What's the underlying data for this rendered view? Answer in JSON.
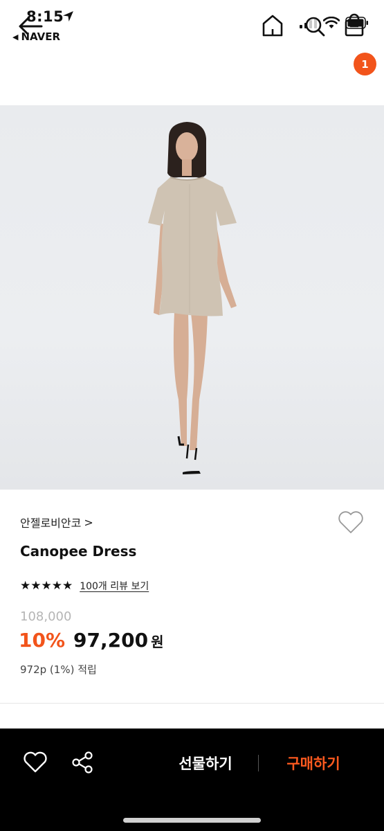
{
  "status_bar": {
    "time": "8:15",
    "back_app": "NAVER"
  },
  "header": {
    "cart_count": "1"
  },
  "product": {
    "image_alt": "Model wearing beige mini dress",
    "brand": "안젤로비안코",
    "brand_chevron": ">",
    "title": "Canopee Dress",
    "stars": "★★★★★",
    "review_link": "100개 리뷰 보기",
    "original_price": "108,000",
    "discount": "10%",
    "sale_price": "97,200",
    "currency": "원",
    "points": "972p (1%) 적립"
  },
  "bottom_bar": {
    "gift_label": "선물하기",
    "buy_label": "구매하기"
  },
  "colors": {
    "accent": "#f2541b",
    "bar_bg": "#000000"
  }
}
